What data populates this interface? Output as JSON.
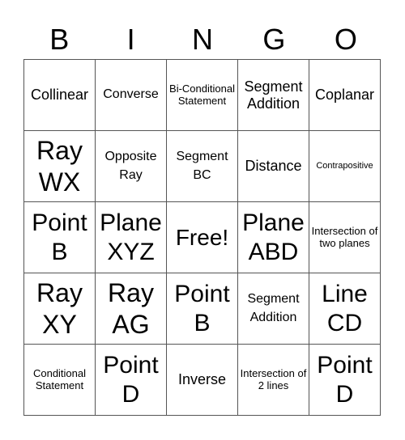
{
  "header": {
    "letters": [
      "B",
      "I",
      "N",
      "G",
      "O"
    ]
  },
  "cells": [
    [
      "Collinear",
      "Converse",
      "Bi-Conditional Statement",
      "Segment Addition",
      "Coplanar"
    ],
    [
      "Ray WX",
      "Opposite Ray",
      "Segment BC",
      "Distance",
      "Contrapositive"
    ],
    [
      "Point B",
      "Plane XYZ",
      "Free!",
      "Plane ABD",
      "Intersection of two planes"
    ],
    [
      "Ray XY",
      "Ray AG",
      "Point B",
      "Segment Addition",
      "Line CD"
    ],
    [
      "Conditional Statement",
      "Point D",
      "Inverse",
      "Intersection of 2 lines",
      "Point D"
    ]
  ]
}
